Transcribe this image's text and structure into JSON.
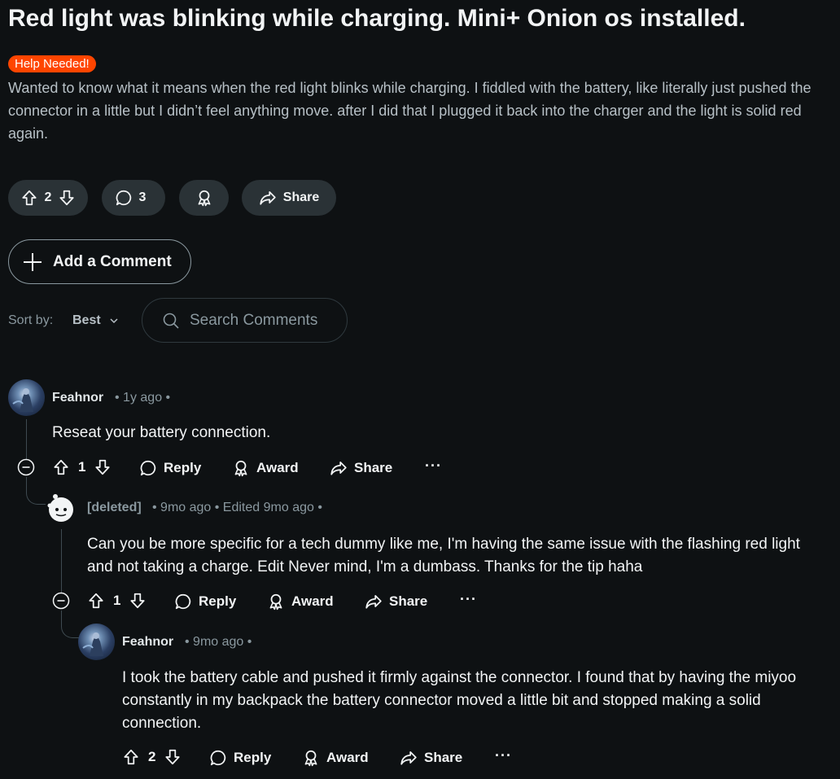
{
  "post": {
    "title": "Red light was blinking while charging. Mini+ Onion os installed.",
    "flair": "Help Needed!",
    "body": "Wanted to know what it means when the red light blinks while charging. I fiddled with the battery, like literally just pushed the connector in a little but I didn’t feel anything move. after I did that I plugged it back into the charger and the light is solid red again.",
    "score": "2",
    "comment_count": "3",
    "share_label": "Share",
    "icons": [
      "upvote-icon",
      "downvote-icon",
      "comment-icon",
      "award-icon",
      "share-icon"
    ]
  },
  "composer": {
    "add_comment_label": "Add a Comment",
    "sort_label": "Sort by:",
    "sort_value": "Best",
    "search_placeholder": "Search Comments"
  },
  "comments": [
    {
      "author": "Feahnor",
      "meta": "• 1y ago •",
      "text": "Reseat your battery connection.",
      "score": "1",
      "reply_label": "Reply",
      "award_label": "Award",
      "share_label": "Share",
      "more_label": "···"
    },
    {
      "author": "[deleted]",
      "meta": "• 9mo ago • Edited 9mo ago •",
      "text": "Can you be more specific for a tech dummy like me, I'm having the same issue with the flashing red light and not taking a charge. Edit Never mind, I'm a dumbass. Thanks for the tip haha",
      "score": "1",
      "reply_label": "Reply",
      "award_label": "Award",
      "share_label": "Share",
      "more_label": "···"
    },
    {
      "author": "Feahnor",
      "meta": "• 9mo ago •",
      "text": "I took the battery cable and pushed it firmly against the connector. I found that by having the miyoo constantly in my backpack the battery connector moved a little bit and stopped making a solid connection.",
      "score": "2",
      "reply_label": "Reply",
      "award_label": "Award",
      "share_label": "Share",
      "more_label": "···"
    }
  ],
  "colors": {
    "background": "#0e1113",
    "pill": "#2a3236",
    "flair": "#ff4500",
    "muted": "#8a989f",
    "text": "#f2f4f5"
  }
}
